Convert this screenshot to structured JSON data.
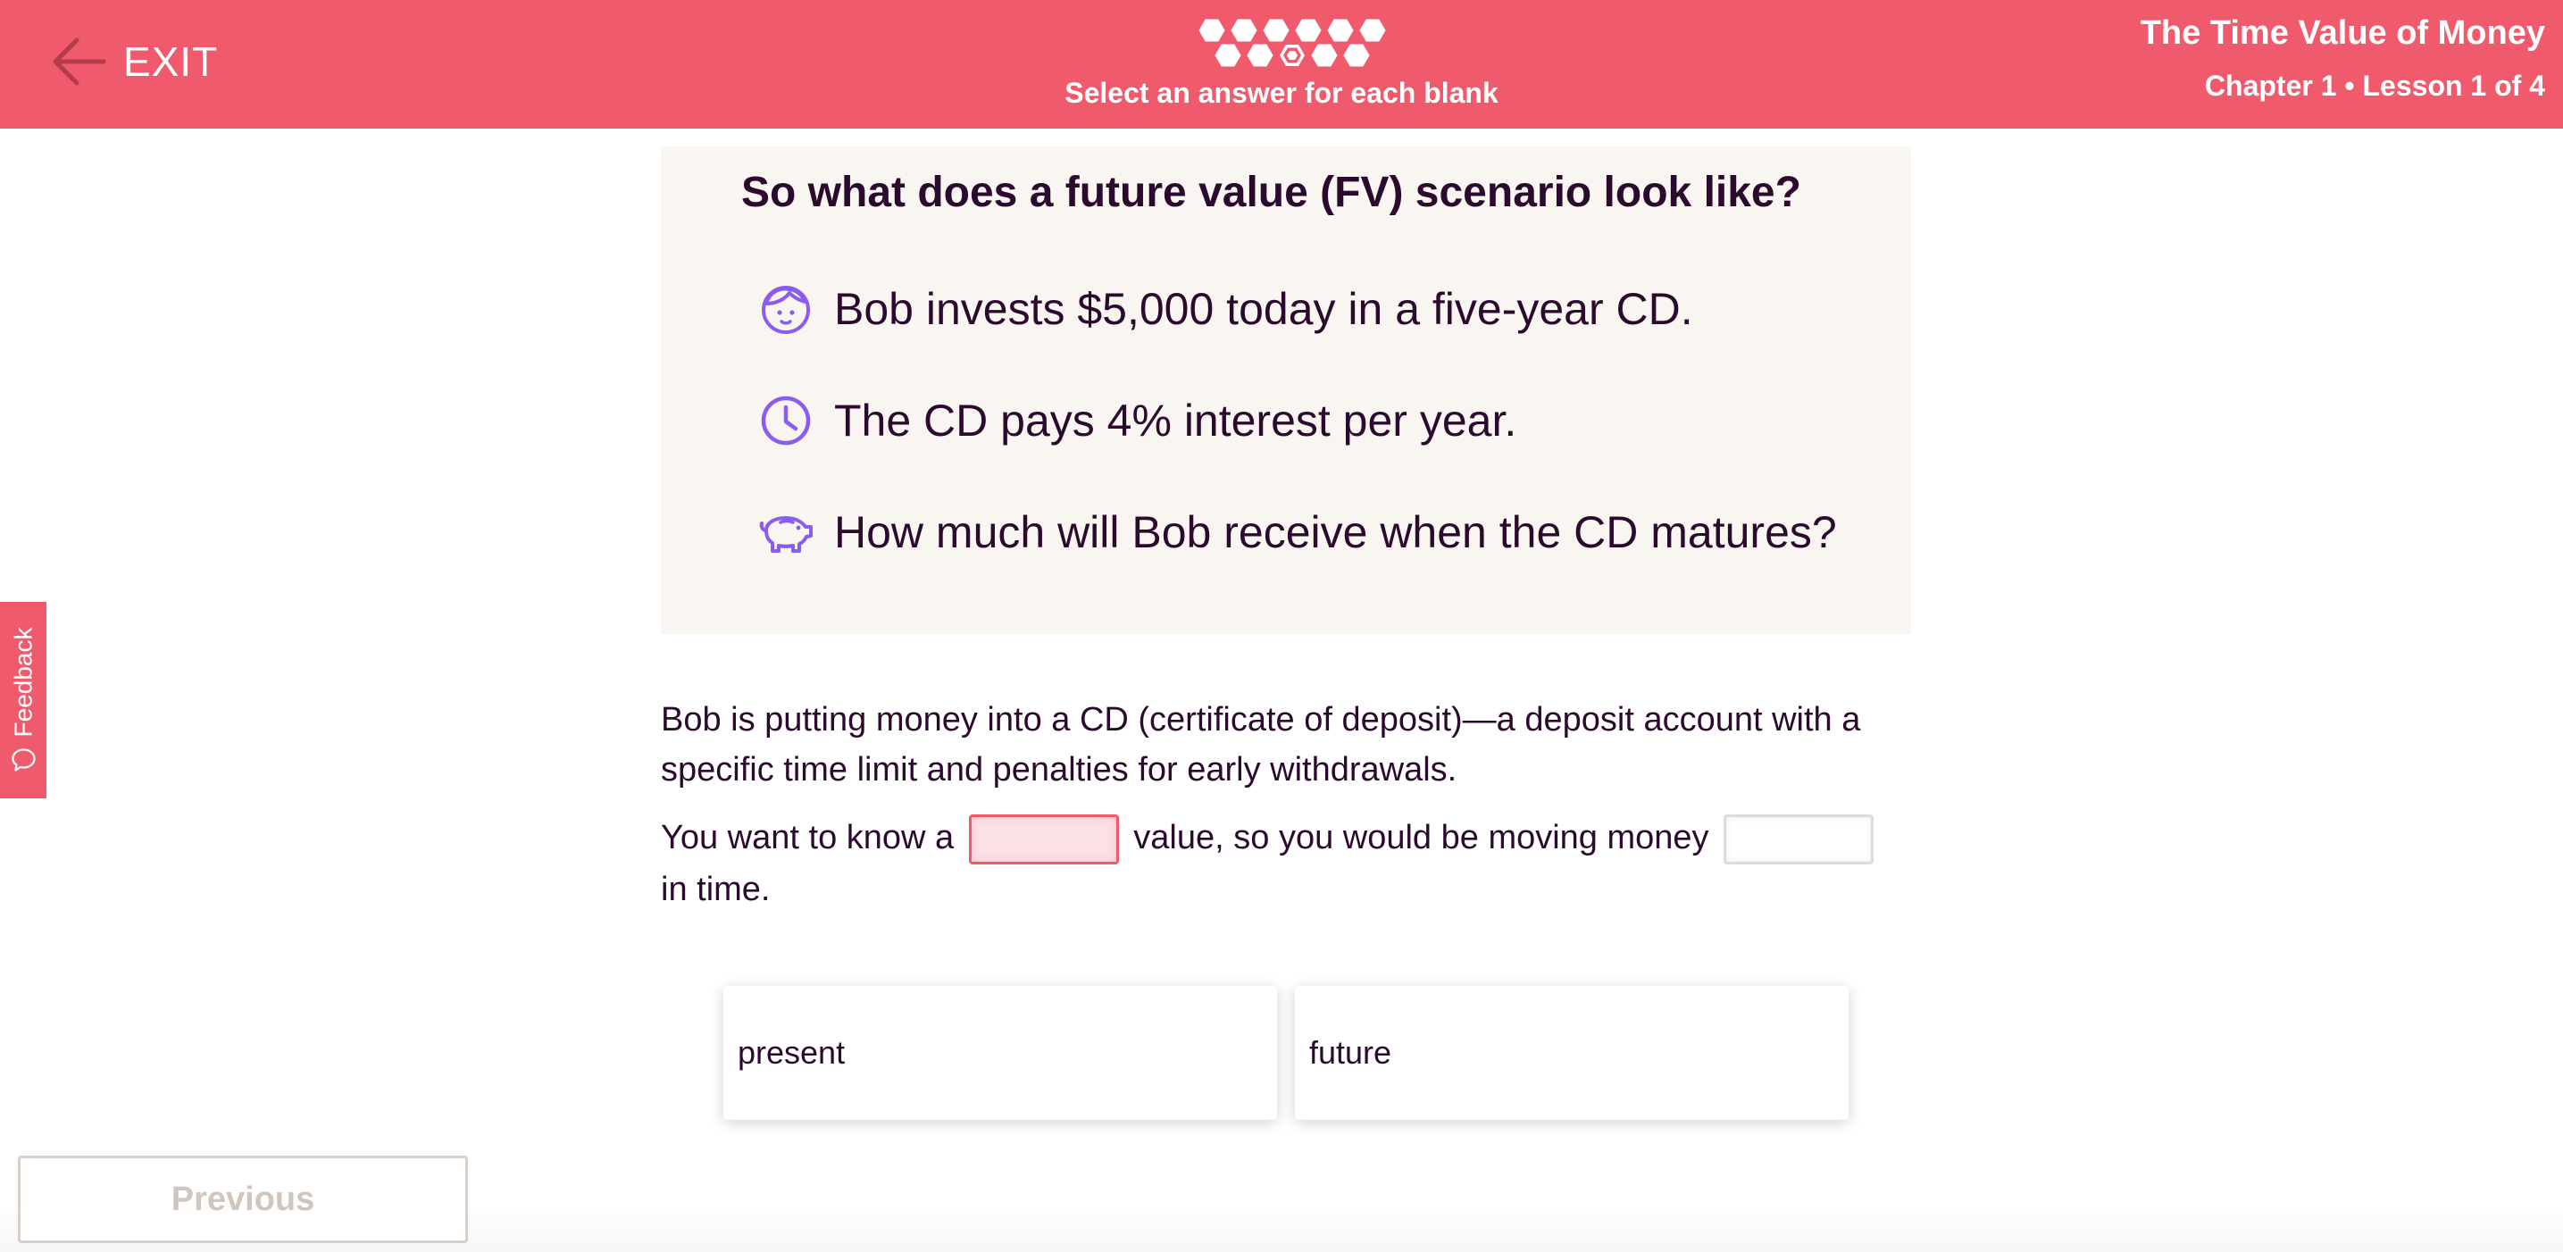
{
  "header": {
    "exit_label": "EXIT",
    "instruction": "Select an answer for each blank",
    "course_title": "The Time Value of Money",
    "lesson_meta": "Chapter 1 • Lesson 1 of 4",
    "progress": {
      "total_steps": 11,
      "current_step": 8
    }
  },
  "feedback": {
    "label": "Feedback"
  },
  "scenario": {
    "title": "So what does a future value (FV) scenario look like?",
    "bullets": [
      {
        "icon": "person-face-icon",
        "text": "Bob invests $5,000 today in a five-year CD."
      },
      {
        "icon": "clock-icon",
        "text": "The CD pays 4% interest per year."
      },
      {
        "icon": "piggy-bank-icon",
        "text": "How much will Bob receive when the CD matures?"
      }
    ]
  },
  "explanation": "Bob is putting money into a CD (certificate of deposit)—a deposit account with a specific time limit and penalties for early withdrawals.",
  "question": {
    "part1": "You want to know a",
    "part2": "value, so you would be moving money",
    "part3": "in time.",
    "blank1": "",
    "blank2": ""
  },
  "choices": [
    "present",
    "future"
  ],
  "footer": {
    "previous_label": "Previous"
  },
  "colors": {
    "accent": "#ef5b6c",
    "icon": "#8a5cf0",
    "text": "#2b0a2e",
    "card_bg": "#f9f5f1"
  }
}
